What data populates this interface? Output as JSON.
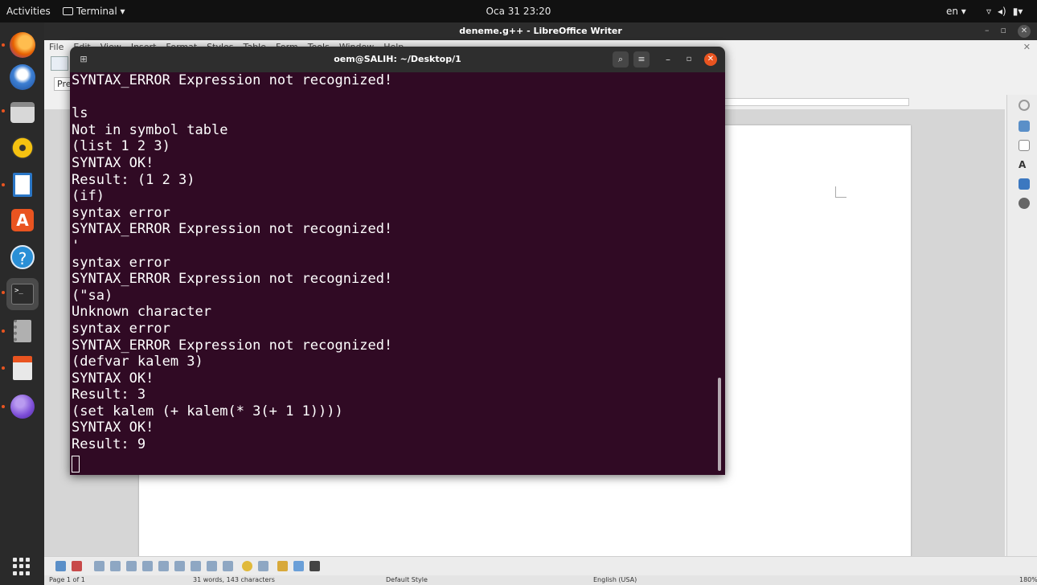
{
  "topbar": {
    "activities": "Activities",
    "app_menu": "Terminal ▾",
    "clock": "Oca 31  23:20",
    "language": "en ▾",
    "status_icons": [
      "wifi-icon",
      "volume-icon",
      "battery-icon"
    ]
  },
  "dock": {
    "items": [
      {
        "name": "firefox",
        "color": "#e66000",
        "running": true
      },
      {
        "name": "thunderbird",
        "color": "#3d7fd3",
        "running": false
      },
      {
        "name": "files",
        "color": "#9a9a9a",
        "running": true
      },
      {
        "name": "rhythmbox",
        "color": "#f5c211",
        "running": false
      },
      {
        "name": "libreoffice-writer",
        "color": "#2a76c6",
        "running": true
      },
      {
        "name": "software",
        "color": "#e95420",
        "running": false
      },
      {
        "name": "help",
        "color": "#2a8fd6",
        "running": false
      },
      {
        "name": "terminal",
        "color": "#2c2c2c",
        "running": true
      },
      {
        "name": "archive",
        "color": "#b0b0b0",
        "running": true
      },
      {
        "name": "document-viewer",
        "color": "#e8e8e8",
        "running": true
      },
      {
        "name": "browser",
        "color": "#7c4dd6",
        "running": true
      }
    ]
  },
  "writer": {
    "title": "deneme.g++ - LibreOffice Writer",
    "menu": [
      "File",
      "Edit",
      "View",
      "Insert",
      "Format",
      "Styles",
      "Table",
      "Form",
      "Tools",
      "Window",
      "Help"
    ],
    "style_box": "Pre",
    "status": {
      "page": "Page 1 of 1",
      "words": "31 words, 143 characters",
      "style": "Default Style",
      "language": "English (USA)",
      "zoom": "180%"
    }
  },
  "terminal": {
    "title": "oem@SALIH: ~/Desktop/1",
    "lines": [
      "SYNTAX_ERROR Expression not recognized!",
      "",
      "ls",
      "Not in symbol table",
      "(list 1 2 3)",
      "SYNTAX OK!",
      "Result: (1 2 3)",
      "(if)",
      "syntax error",
      "SYNTAX_ERROR Expression not recognized!",
      "'",
      "syntax error",
      "SYNTAX_ERROR Expression not recognized!",
      "(\"sa)",
      "Unknown character",
      "syntax error",
      "SYNTAX_ERROR Expression not recognized!",
      "(defvar kalem 3)",
      "SYNTAX OK!",
      "Result: 3",
      "(set kalem (+ kalem(* 3(+ 1 1))))",
      "SYNTAX OK!",
      "Result: 9"
    ]
  },
  "colors": {
    "terminal_bg": "#300a24",
    "accent": "#e95420"
  }
}
